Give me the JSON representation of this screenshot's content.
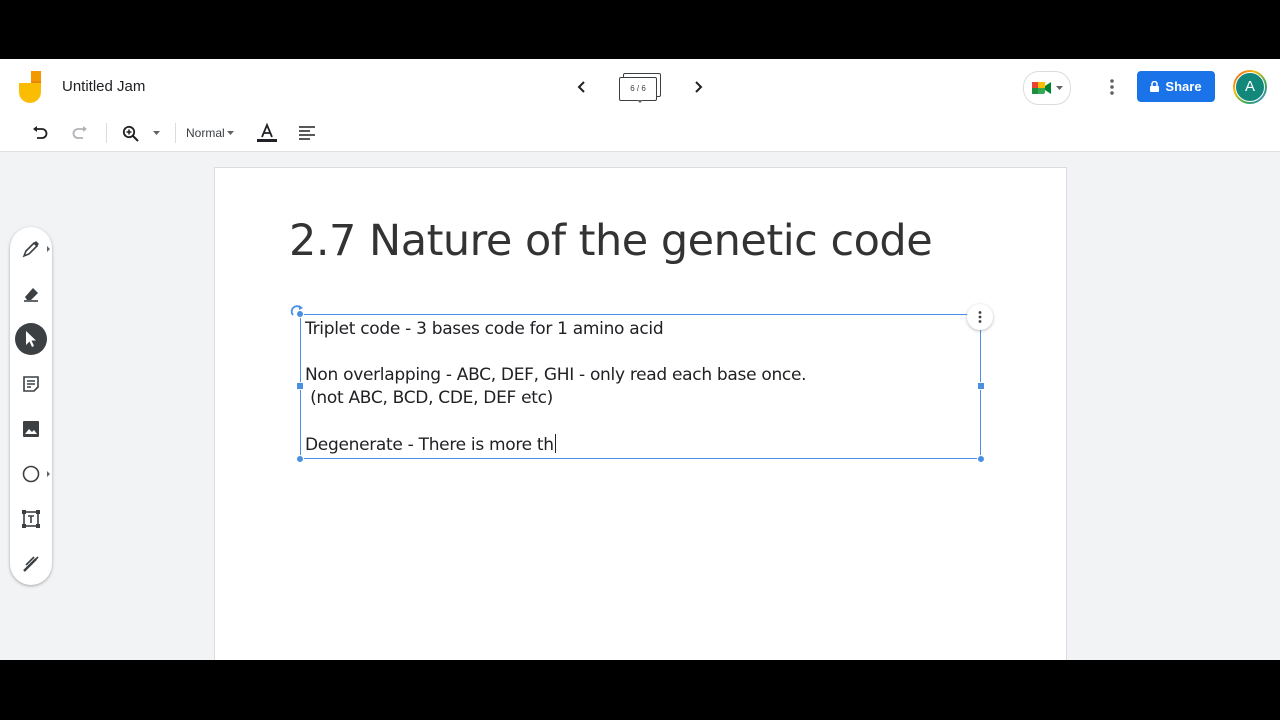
{
  "header": {
    "title": "Untitled Jam",
    "frame_indicator": "6 / 6",
    "share_label": "Share",
    "avatar_initial": "A"
  },
  "toolbar": {
    "text_style": "Normal"
  },
  "slide": {
    "title": "2.7 Nature of the genetic code",
    "lines": [
      "Triplet code - 3 bases code for 1 amino acid",
      "Non overlapping - ABC, DEF, GHI - only read each base once.",
      " (not ABC, BCD, CDE, DEF etc)",
      "Degenerate - There is more th"
    ]
  },
  "sidebar": {
    "tools": [
      "pen-tool",
      "eraser-tool",
      "select-tool",
      "sticky-note-tool",
      "image-tool",
      "circle-tool",
      "text-box-tool",
      "laser-tool"
    ],
    "active_tool": "select-tool"
  },
  "colors": {
    "accent": "#1a73e8",
    "selection": "#4a90e2",
    "active_tool_bg": "#3c4043",
    "canvas_bg": "#f1f3f4"
  }
}
